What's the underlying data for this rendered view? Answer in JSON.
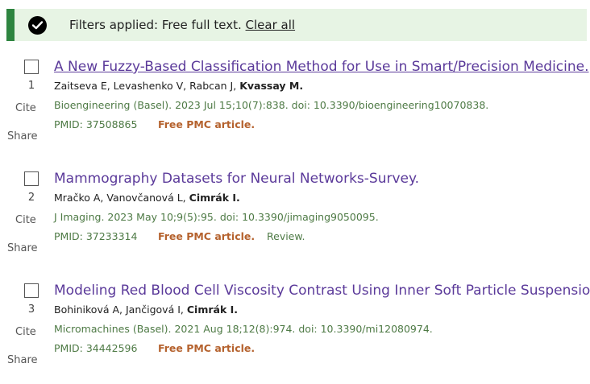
{
  "banner": {
    "text": "Filters applied: Free full text.",
    "clear_label": "Clear all",
    "icon": "check-circle-icon",
    "accent_color": "#2e8540",
    "background_color": "#e7f4e4"
  },
  "results": [
    {
      "number": "1",
      "cite_label": "Cite",
      "share_label": "Share",
      "title": "A New Fuzzy-Based Classification Method for Use in Smart/Precision Medicine.",
      "authors_plain": "Zaitseva E, Levashenko V, Rabcan J,",
      "authors_bold": "Kvassay M.",
      "citation": "Bioengineering (Basel). 2023 Jul 15;10(7):838. doi: 10.3390/bioengineering10070838.",
      "pmid": "PMID: 37508865",
      "free_pmc": "Free PMC article.",
      "review": ""
    },
    {
      "number": "2",
      "cite_label": "Cite",
      "share_label": "Share",
      "title": "Mammography Datasets for Neural Networks-Survey.",
      "authors_plain": "Mračko A, Vanovčanová L,",
      "authors_bold": "Cimrák I.",
      "citation": "J Imaging. 2023 May 10;9(5):95. doi: 10.3390/jimaging9050095.",
      "pmid": "PMID: 37233314",
      "free_pmc": "Free PMC article.",
      "review": "Review."
    },
    {
      "number": "3",
      "cite_label": "Cite",
      "share_label": "Share",
      "title": "Modeling Red Blood Cell Viscosity Contrast Using Inner Soft Particle Suspension.",
      "authors_plain": "Bohiniková A, Jančigová I,",
      "authors_bold": "Cimrák I.",
      "citation": "Micromachines (Basel). 2021 Aug 18;12(8):974. doi: 10.3390/mi12080974.",
      "pmid": "PMID: 34442596",
      "free_pmc": "Free PMC article.",
      "review": ""
    }
  ]
}
